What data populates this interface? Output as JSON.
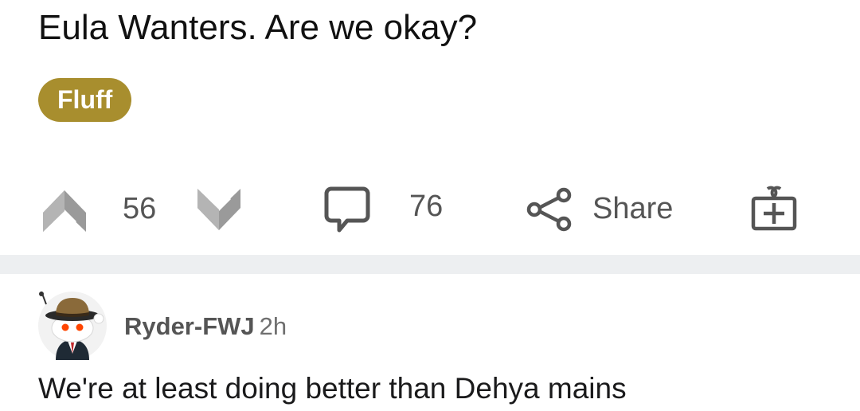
{
  "post": {
    "title": "Eula Wanters. Are we okay?",
    "flair": "Fluff",
    "flair_color": "#a88e2e",
    "upvote_icon": "upvote-arrow-icon",
    "score": "56",
    "downvote_icon": "downvote-arrow-icon",
    "comment_icon": "comment-bubble-icon",
    "comment_count": "76",
    "share_icon": "share-icon",
    "share_label": "Share",
    "award_icon": "gift-award-icon"
  },
  "comment": {
    "avatar_icon": "snoo-avatar-icon",
    "username": "Ryder-FWJ",
    "time": "2h",
    "body": "We're at least doing better than Dehya mains"
  }
}
